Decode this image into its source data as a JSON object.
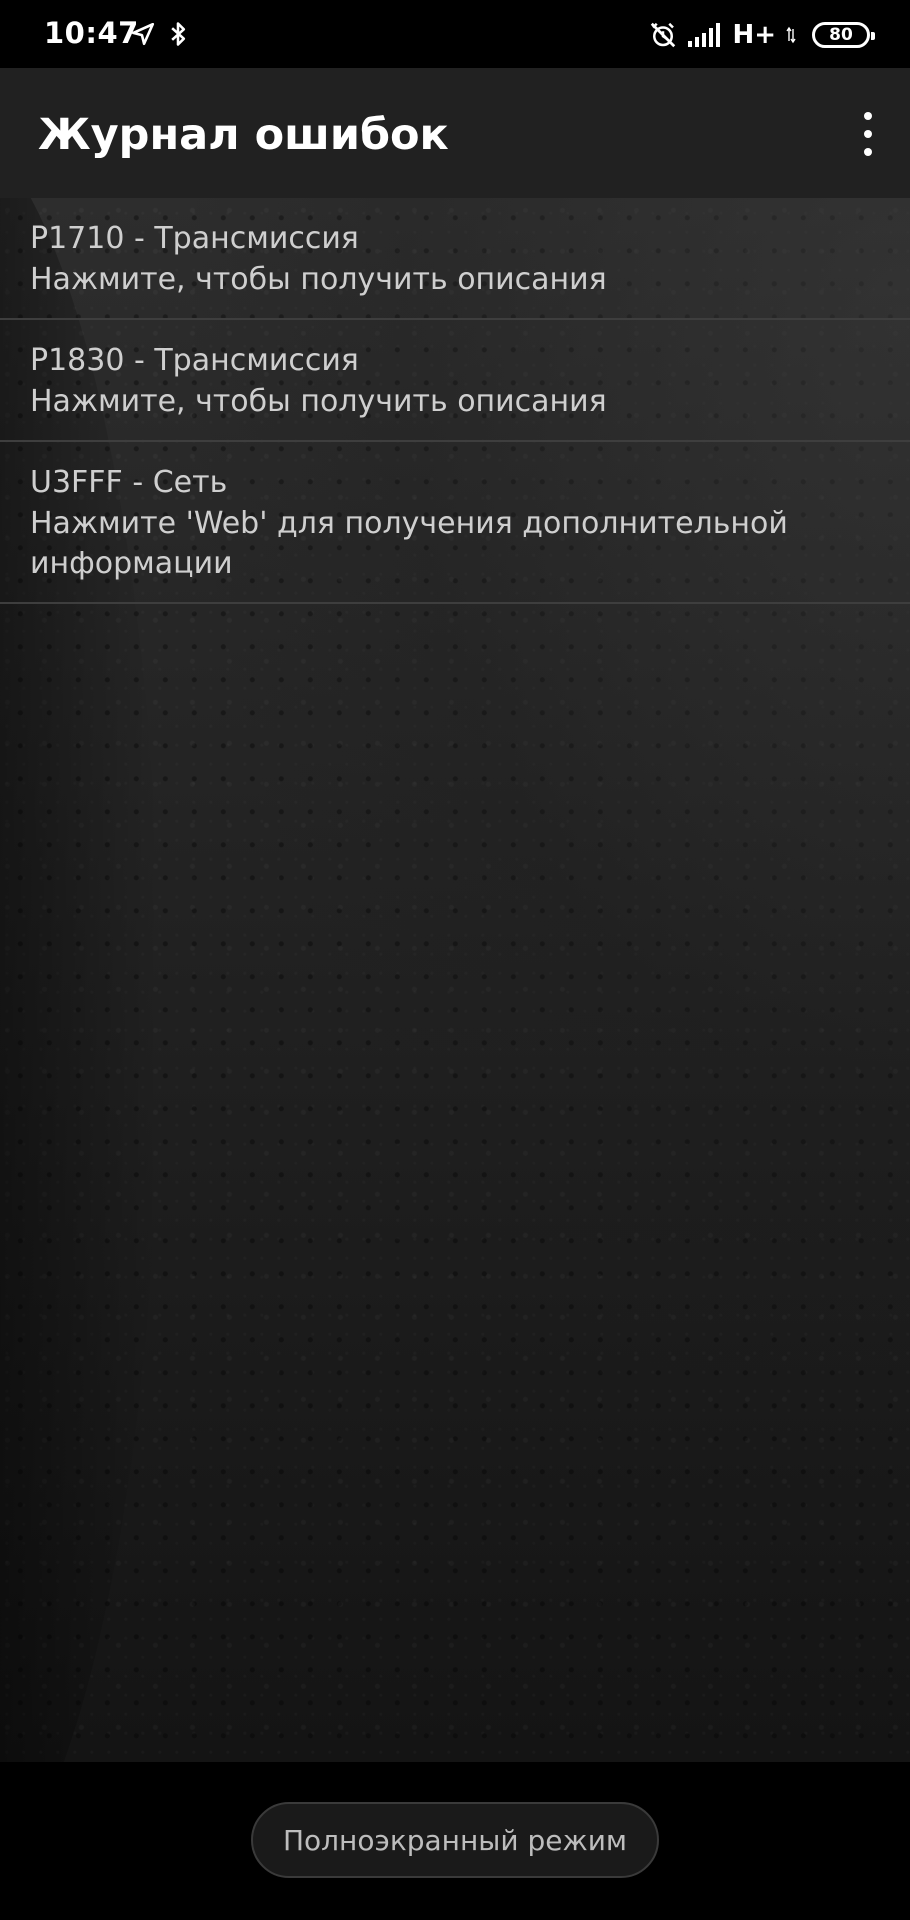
{
  "status_bar": {
    "time": "10:47",
    "network": "H+",
    "battery": "80"
  },
  "app_bar": {
    "title": "Журнал ошибок"
  },
  "errors": [
    {
      "title": "P1710 - Трансмиссия",
      "subtitle": "Нажмите, чтобы получить описания"
    },
    {
      "title": "P1830 - Трансмиссия",
      "subtitle": "Нажмите, чтобы получить описания"
    },
    {
      "title": "U3FFF - Сеть",
      "subtitle": "Нажмите 'Web' для получения дополнительной информации"
    }
  ],
  "bottom": {
    "fullscreen_label": "Полноэкранный режим"
  },
  "colors": {
    "app_bar": "#212121",
    "background": "#000000",
    "text": "#cfcfcf"
  }
}
